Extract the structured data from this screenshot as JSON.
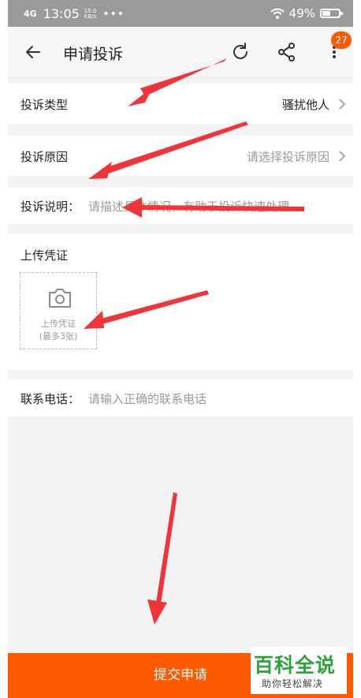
{
  "status_bar": {
    "signal": "4G",
    "time": "13:05",
    "speed_value": "15.0",
    "speed_unit": "KB/s",
    "dots": "•••",
    "battery": "49%",
    "battery_level": 0.49
  },
  "header": {
    "title": "申请投诉",
    "badge": "27"
  },
  "form": {
    "type": {
      "label": "投诉类型",
      "value": "骚扰他人"
    },
    "reason": {
      "label": "投诉原因",
      "placeholder": "请选择投诉原因"
    },
    "description": {
      "label": "投诉说明：",
      "placeholder": "请描述具体情况，有助于投诉快速处理"
    },
    "upload": {
      "label": "上传凭证",
      "box_text": "上传凭证",
      "box_limit": "(最多3张)"
    },
    "phone": {
      "label": "联系电话：",
      "placeholder": "请输入正确的联系电话"
    }
  },
  "submit_label": "提交申请",
  "watermark": {
    "brand": "百科全说",
    "slogan": "助你轻松解决"
  },
  "colors": {
    "accent": "#ff5a00",
    "arrow": "#f0353a",
    "watermark": "#2aa339"
  }
}
